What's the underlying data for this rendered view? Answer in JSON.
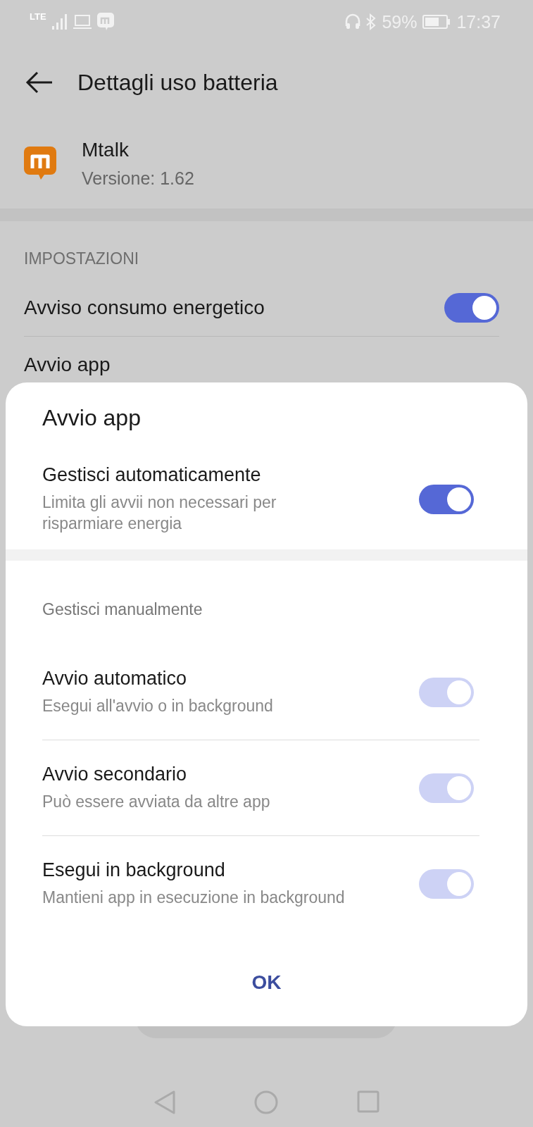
{
  "status_bar": {
    "network": "LTE",
    "battery": "59%",
    "time": "17:37"
  },
  "header": {
    "title": "Dettagli uso batteria"
  },
  "app": {
    "name": "Mtalk",
    "version": "Versione: 1.62"
  },
  "settings": {
    "heading": "IMPOSTAZIONI",
    "items": [
      {
        "label": "Avviso consumo energetico",
        "kind": "toggle",
        "on": true
      },
      {
        "label": "Avvio app",
        "kind": "plain"
      }
    ]
  },
  "dialog": {
    "title": "Avvio app",
    "auto": {
      "label": "Gestisci automaticamente",
      "description": "Limita gli avvii non necessari per risparmiare energia",
      "on": true
    },
    "manual_heading": "Gestisci manualmente",
    "items": [
      {
        "label": "Avvio automatico",
        "description": "Esegui all'avvio o in background",
        "on": true,
        "disabled": true
      },
      {
        "label": "Avvio secondario",
        "description": "Può essere avviata da altre app",
        "on": true,
        "disabled": true
      },
      {
        "label": "Esegui in background",
        "description": "Mantieni app in esecuzione in background",
        "on": true,
        "disabled": true
      }
    ],
    "button": "OK"
  }
}
